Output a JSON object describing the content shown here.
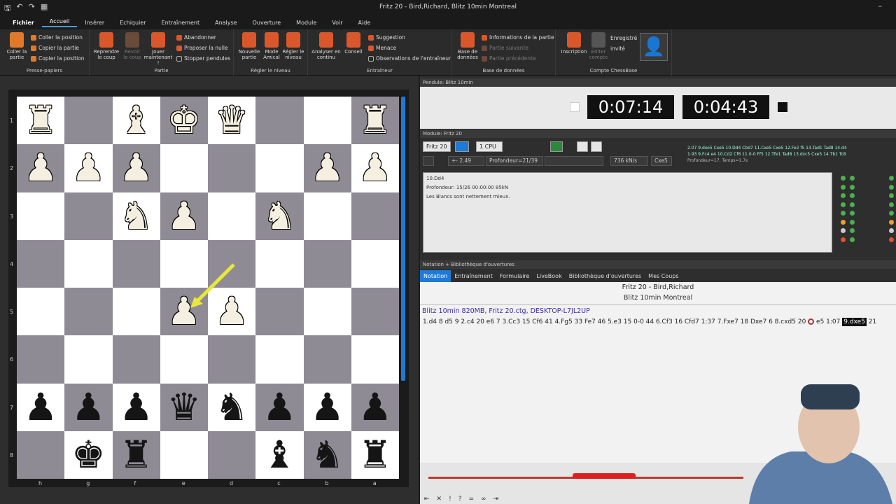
{
  "window": {
    "title": "Fritz 20 - Bird,Richard, Blitz 10min Montreal",
    "minimize": "–"
  },
  "menu": [
    {
      "label": "Fichier",
      "cls": "file"
    },
    {
      "label": "Accueil",
      "cls": "active"
    },
    {
      "label": "Insérer",
      "cls": ""
    },
    {
      "label": "Echiquier",
      "cls": ""
    },
    {
      "label": "Entraînement",
      "cls": ""
    },
    {
      "label": "Analyse",
      "cls": ""
    },
    {
      "label": "Ouverture",
      "cls": ""
    },
    {
      "label": "Module",
      "cls": ""
    },
    {
      "label": "Voir",
      "cls": ""
    },
    {
      "label": "Aide",
      "cls": ""
    }
  ],
  "ribbon": {
    "clipboard": {
      "title": "Presse-papiers",
      "paste_game": "Coller la partie",
      "paste_pos": "Coller la position",
      "copy_game": "Copier la partie",
      "copy_pos": "Copier la position"
    },
    "game": {
      "title": "Partie",
      "take_back": "Reprendre le coup",
      "replay": "Revoir le coup",
      "play_now": "Jouer maintenant !",
      "resign": "Abandonner",
      "offer_draw": "Proposer la nulle",
      "stop_clocks": "Stopper pendules"
    },
    "level": {
      "title": "Régler le niveau",
      "new_game": "Nouvelle partie",
      "friendly": "Mode Amical",
      "set_level": "Régler le niveau"
    },
    "trainer": {
      "title": "Entraîneur",
      "analyse": "Analyser en continu",
      "advice": "Conseil",
      "suggestion": "Suggestion",
      "threat": "Menace",
      "coach_comments": "Observations de l'entraîneur"
    },
    "database": {
      "title": "Base de données",
      "db": "Base de données",
      "game_info": "Informations de la partie",
      "next_game": "Partie suivante",
      "prev_game": "Partie précédente"
    },
    "account": {
      "title": "Compte ChessBase",
      "register": "Inscription",
      "edit_account": "Éditer compte",
      "registered": "Enregistré",
      "guest": "invité"
    }
  },
  "board": {
    "ranks": [
      "1",
      "2",
      "3",
      "4",
      "5",
      "6",
      "7",
      "8"
    ],
    "files": [
      "h",
      "g",
      "f",
      "e",
      "d",
      "c",
      "b",
      "a"
    ],
    "rows": [
      [
        "wR",
        "",
        "wB",
        "wK",
        "wQ",
        "",
        "",
        "wR"
      ],
      [
        "wP",
        "wP",
        "wP",
        "",
        "",
        "",
        "wP",
        "wP"
      ],
      [
        "",
        "",
        "wN",
        "wP",
        "",
        "wN",
        "",
        ""
      ],
      [
        "",
        "",
        "",
        "",
        "",
        "",
        "",
        ""
      ],
      [
        "",
        "",
        "",
        "wP",
        "wP",
        "",
        "",
        ""
      ],
      [
        "",
        "",
        "",
        "",
        "",
        "",
        "",
        ""
      ],
      [
        "bP",
        "bP",
        "bP",
        "bQ",
        "bN",
        "bP",
        "bP",
        "bP"
      ],
      [
        "",
        "bK",
        "bR",
        "",
        "",
        "bB",
        "bN",
        "bR"
      ]
    ]
  },
  "clock": {
    "header": "Pendule: Blitz 10min",
    "white_time": "0:07:14",
    "black_time": "0:04:43"
  },
  "engine": {
    "header": "Module: Fritz 20",
    "name": "Fritz 20",
    "cpu": "1 CPU",
    "eval": "+- 2.49",
    "depth": "Profondeur=21/39",
    "speed": "736 kN/s",
    "best": "Cxe5",
    "line1": "2.07 9.dxe5 Cxe5 10.Dd4 Cbd7 11.Cxe5 Cxe5 12.Fe2 f5 13.Tad1 Tad8 14.d4",
    "line2": "1.93 9.Fc4 e4 10.Cd2 Cf6 11.0-0 Ff5 12.Tfe1 Tad8 13.dxc5 Cxe5 14.Tb1 Tc8",
    "line3": "Profondeur=17, Temps=1.7s",
    "analysis_move": "10.Dd4",
    "analysis_depth": "Profondeur: 15/26 00:00:00 85kN",
    "analysis_text": "Les Blancs sont nettement mieux."
  },
  "notation": {
    "header": "Notation + Bibliothèque d'ouvertures",
    "tabs": [
      "Notation",
      "Entraînement",
      "Formulaire",
      "LiveBook",
      "Bibliothèque d'ouvertures",
      "Mes Coups"
    ],
    "game_title": "Fritz 20 - Bird,Richard",
    "event": "Blitz 10min Montreal",
    "header_line": "Blitz 10min 820MB, Fritz 20.ctg, DESKTOP-L7JL2UP",
    "moves_pre": "1.d4 8  d5 9  2.c4 20  e6 7  3.Cc3 15  Cf6 41  4.Fg5 33  Fe7 46  5.e3 15  0-0 44  6.Cf3 16  Cfd7 1:37  7.Fxe7 18  Dxe7 6  8.cxd5 20",
    "moves_mid": "e5 1:07",
    "moves_cur": "9.dxe5",
    "moves_post": "21"
  }
}
